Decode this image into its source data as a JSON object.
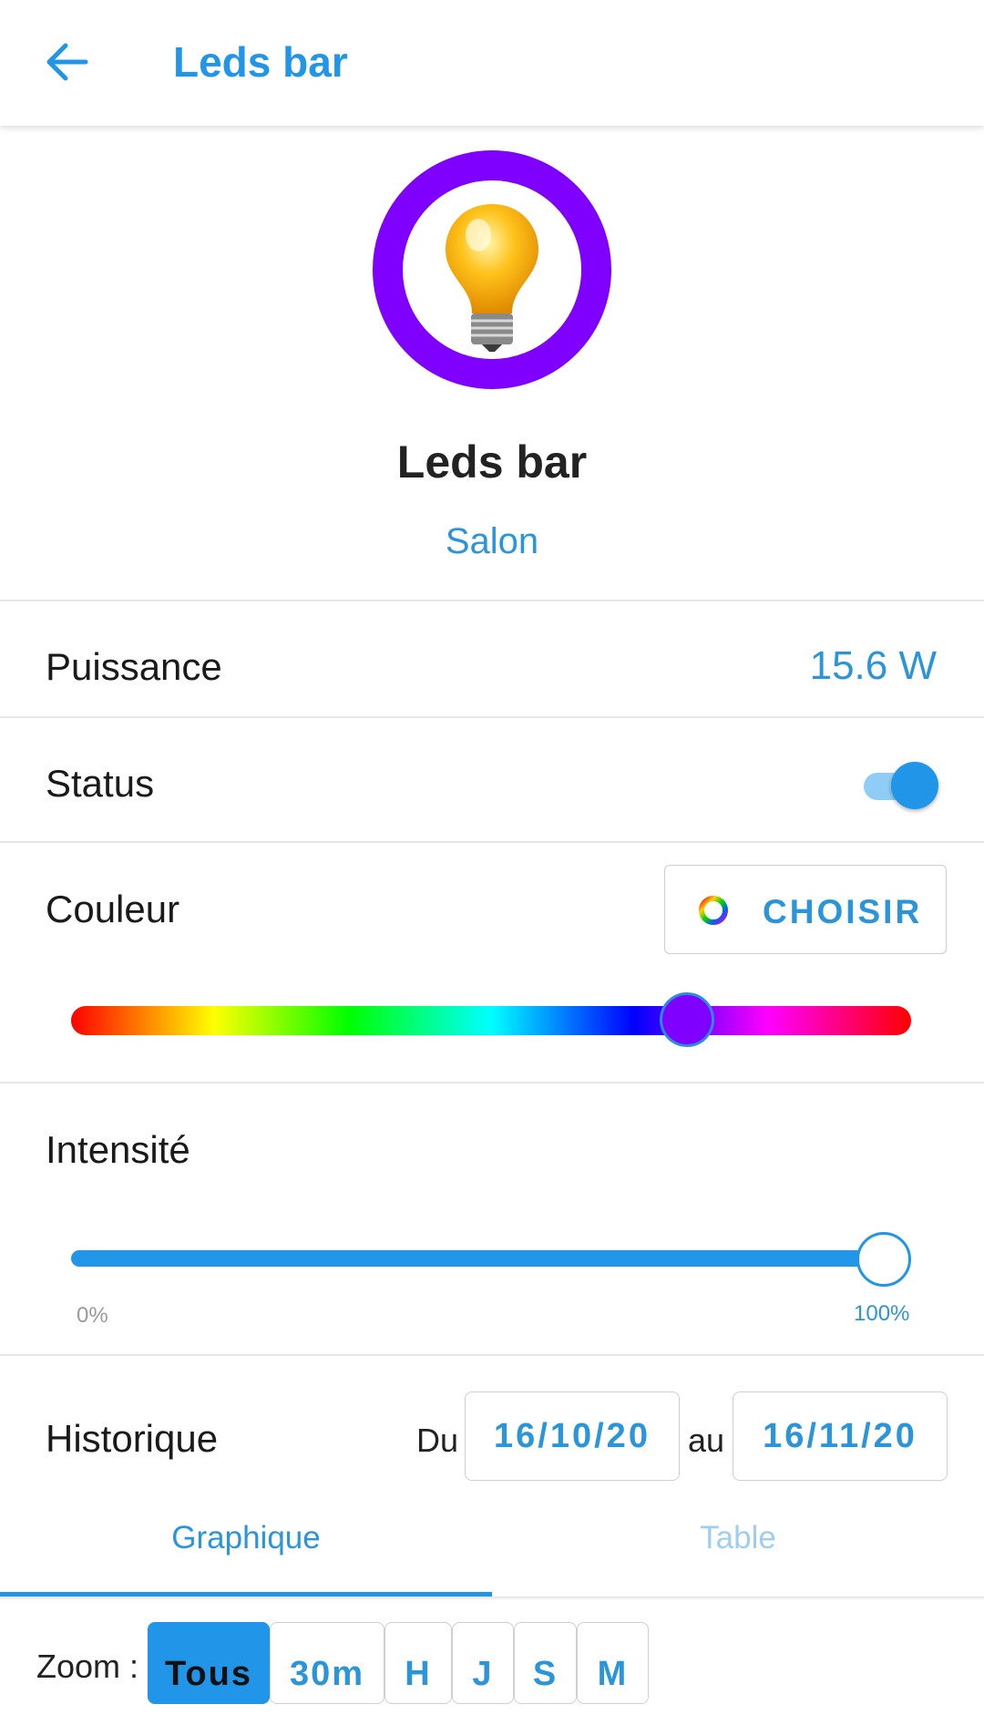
{
  "header": {
    "title": "Leds bar"
  },
  "device": {
    "name": "Leds bar",
    "room": "Salon",
    "ring_color": "#8000ff"
  },
  "power": {
    "label": "Puissance",
    "value": "15.6 W"
  },
  "status": {
    "label": "Status",
    "on": true
  },
  "color": {
    "label": "Couleur",
    "choose_label": "CHOISIR",
    "current_hue": "#8000ff",
    "hue_position_fraction": 0.74
  },
  "intensity": {
    "label": "Intensité",
    "min_label": "0%",
    "max_label": "100%",
    "value_percent": 100
  },
  "history": {
    "label": "Historique",
    "from_label": "Du",
    "from_date": "16/10/20",
    "to_label": "au",
    "to_date": "16/11/20",
    "tabs": [
      {
        "label": "Graphique",
        "active": true
      },
      {
        "label": "Table",
        "active": false
      }
    ]
  },
  "zoom": {
    "label": "Zoom :",
    "options": [
      {
        "label": "Tous",
        "active": true
      },
      {
        "label": "30m",
        "active": false
      },
      {
        "label": "H",
        "active": false
      },
      {
        "label": "J",
        "active": false
      },
      {
        "label": "S",
        "active": false
      },
      {
        "label": "M",
        "active": false
      }
    ]
  },
  "colors": {
    "accent": "#2196e8",
    "text": "#222222"
  }
}
